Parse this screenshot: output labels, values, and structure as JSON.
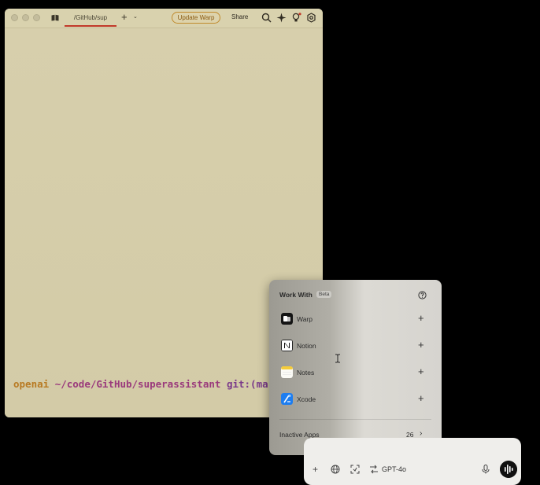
{
  "warp": {
    "tab_label": "/GitHub/sup",
    "new_tab": "+",
    "tab_dropdown": "⌄",
    "update_label": "Update Warp",
    "share_label": "Share",
    "prompt": {
      "user": "openai",
      "path": "~/code/GitHub/superassistant",
      "git": "git:(ma"
    }
  },
  "popover": {
    "title": "Work With",
    "badge": "Beta",
    "apps": [
      {
        "label": "Warp",
        "icon": "warp-icon"
      },
      {
        "label": "Notion",
        "icon": "notion-icon"
      },
      {
        "label": "Notes",
        "icon": "notes-icon"
      },
      {
        "label": "Xcode",
        "icon": "xcode-icon"
      }
    ],
    "add_label": "+",
    "inactive_label": "Inactive Apps",
    "inactive_count": "26",
    "chevron": "›"
  },
  "inputbar": {
    "plus": "+",
    "model": "GPT-4o"
  },
  "colors": {
    "warp_bg": "#d6ceaa",
    "update_border": "#c08a2c",
    "tab_accent": "#c23a2a",
    "prompt_user": "#b87a22",
    "prompt_path": "#9a3a7c"
  }
}
